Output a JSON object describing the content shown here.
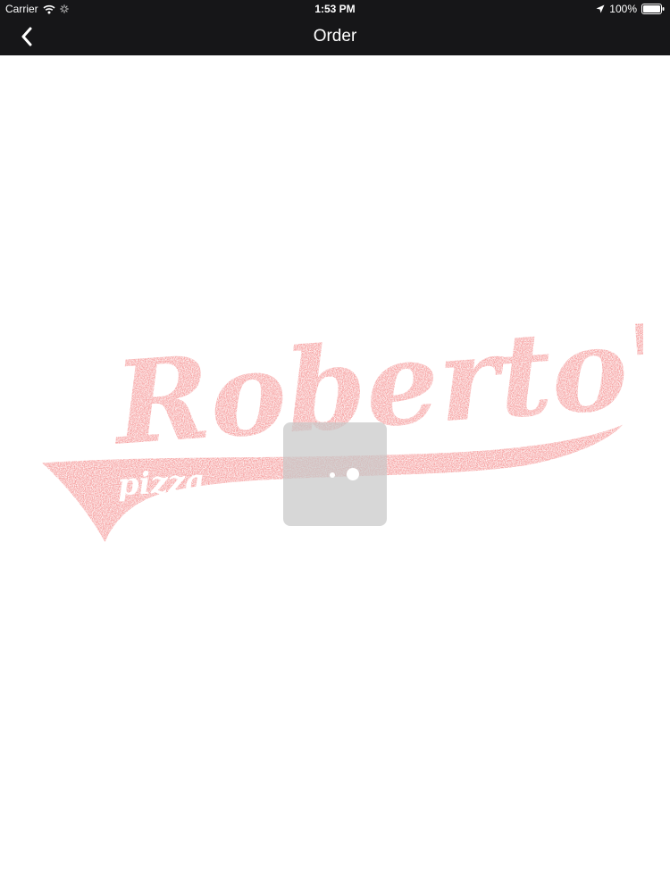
{
  "status_bar": {
    "carrier": "Carrier",
    "time": "1:53 PM",
    "battery_percent": "100%",
    "icons": [
      "wifi-icon",
      "activity-spinner-icon",
      "location-arrow-icon",
      "battery-icon"
    ]
  },
  "nav_bar": {
    "title": "Order",
    "back_icon": "chevron-left-icon"
  },
  "content": {
    "logo": {
      "wordmark": "Roberto's",
      "tagline": "pizza",
      "color": "#f7a3a3"
    },
    "loading": {
      "icon": "loading-dots-icon"
    }
  },
  "colors": {
    "bar_background": "#161618",
    "page_background": "#ffffff",
    "logo_pink": "#f7a3a3"
  }
}
